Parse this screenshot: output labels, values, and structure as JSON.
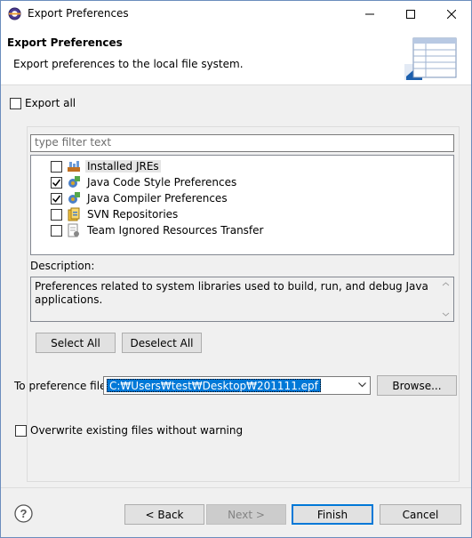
{
  "window": {
    "title": "Export Preferences"
  },
  "header": {
    "title": "Export Preferences",
    "description": "Export preferences to the local file system."
  },
  "export_all": {
    "label": "Export all",
    "checked": false
  },
  "filter": {
    "placeholder": "type filter text"
  },
  "tree": {
    "items": [
      {
        "label": "Installed JREs",
        "checked": false,
        "selected": true,
        "icon": "jre-icon"
      },
      {
        "label": "Java Code Style Preferences",
        "checked": true,
        "selected": false,
        "icon": "java-prefs-icon"
      },
      {
        "label": "Java Compiler Preferences",
        "checked": true,
        "selected": false,
        "icon": "java-prefs-icon"
      },
      {
        "label": "SVN Repositories",
        "checked": false,
        "selected": false,
        "icon": "svn-icon"
      },
      {
        "label": "Team Ignored Resources Transfer",
        "checked": false,
        "selected": false,
        "icon": "team-icon"
      }
    ]
  },
  "description": {
    "label": "Description:",
    "text": "Preferences related to system libraries used to build, run, and debug Java applications."
  },
  "buttons": {
    "select_all": "Select All",
    "deselect_all": "Deselect All",
    "browse": "Browse...",
    "back": "< Back",
    "next": "Next >",
    "finish": "Finish",
    "cancel": "Cancel"
  },
  "preference_file": {
    "label": "To preference file:",
    "value": "C:₩Users₩test₩Desktop₩201111.epf"
  },
  "overwrite": {
    "label": "Overwrite existing files without warning",
    "checked": false
  },
  "colors": {
    "accent": "#0078d7",
    "background": "#f0f0f0"
  }
}
